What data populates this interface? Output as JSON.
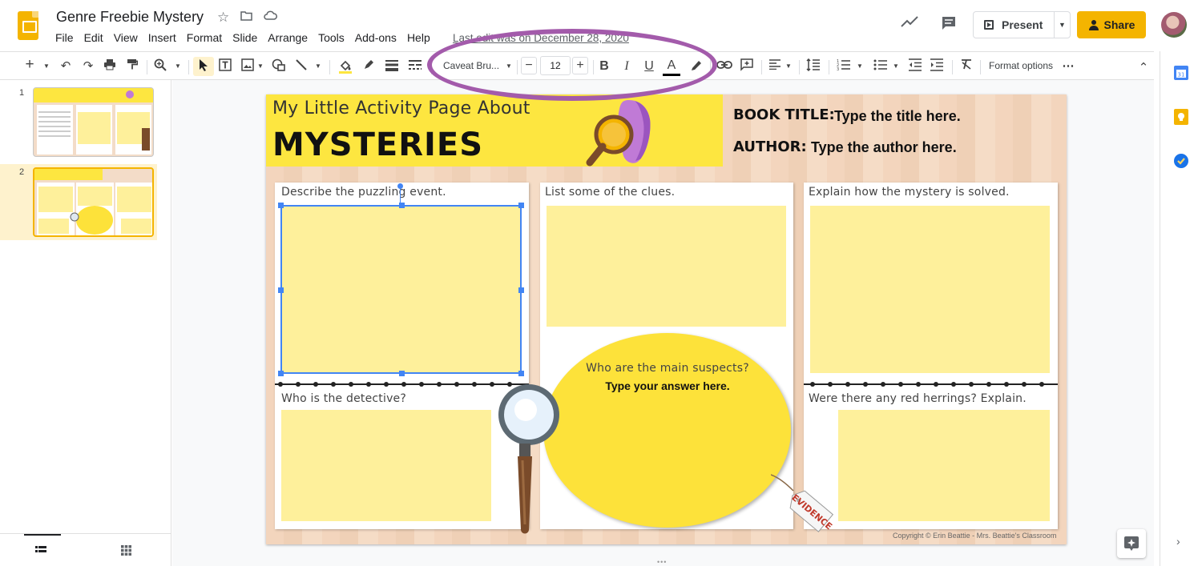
{
  "header": {
    "doc_title": "Genre Freebie Mystery",
    "menu": [
      "File",
      "Edit",
      "View",
      "Insert",
      "Format",
      "Slide",
      "Arrange",
      "Tools",
      "Add-ons",
      "Help"
    ],
    "last_edit": "Last edit was on December 28, 2020",
    "present_label": "Present",
    "share_label": "Share"
  },
  "toolbar": {
    "font_name": "Caveat Bru...",
    "font_size": "12",
    "bold": "B",
    "italic": "I",
    "underline": "U",
    "text_color": "A",
    "format_options": "Format options",
    "more": "⋯",
    "collapse": "⌃"
  },
  "filmstrip": {
    "slides": [
      {
        "number": "1"
      },
      {
        "number": "2"
      }
    ]
  },
  "slide": {
    "title_small": "My Little Activity Page About",
    "title_big": "MYSTERIES",
    "book_title_label": "BOOK TITLE:",
    "book_title_value": "Type the title here.",
    "author_label": "AUTHOR:",
    "author_value": "Type the author here.",
    "prompt_event": "Describe the puzzling event.",
    "prompt_clues": "List some of the clues.",
    "prompt_solved": "Explain how the mystery is solved.",
    "prompt_detective": "Who is the detective?",
    "prompt_suspects": "Who are the main suspects?",
    "suspects_answer": "Type your answer here.",
    "prompt_herrings": "Were there any red herrings? Explain.",
    "evidence_tag": "EVIDENCE",
    "copyright": "Copyright © Erin Beattie - Mrs. Beattie's Classroom"
  },
  "colors": {
    "accent_yellow": "#f4b400",
    "slide_yellow": "#fde640",
    "box_yellow": "#fef09b",
    "annotation_purple": "#a35bab",
    "selection_blue": "#4285f4"
  },
  "icons": [
    "slides-logo-icon",
    "star-icon",
    "move-folder-icon",
    "cloud-status-icon",
    "activity-trend-icon",
    "comment-icon",
    "present-icon",
    "lock-icon",
    "undo-icon",
    "redo-icon",
    "print-icon",
    "paint-format-icon",
    "zoom-icon",
    "select-icon",
    "textbox-icon",
    "image-icon",
    "shape-icon",
    "line-icon",
    "fill-color-icon",
    "border-color-icon",
    "border-weight-icon",
    "border-dash-icon",
    "link-icon",
    "add-comment-icon",
    "align-icon",
    "line-spacing-icon",
    "numbered-list-icon",
    "bulleted-list-icon",
    "indent-less-icon",
    "indent-more-icon",
    "clear-formatting-icon",
    "calendar-icon",
    "keep-icon",
    "tasks-icon",
    "explore-icon",
    "grid-view-icon",
    "filmstrip-view-icon",
    "magnifier-icon"
  ]
}
